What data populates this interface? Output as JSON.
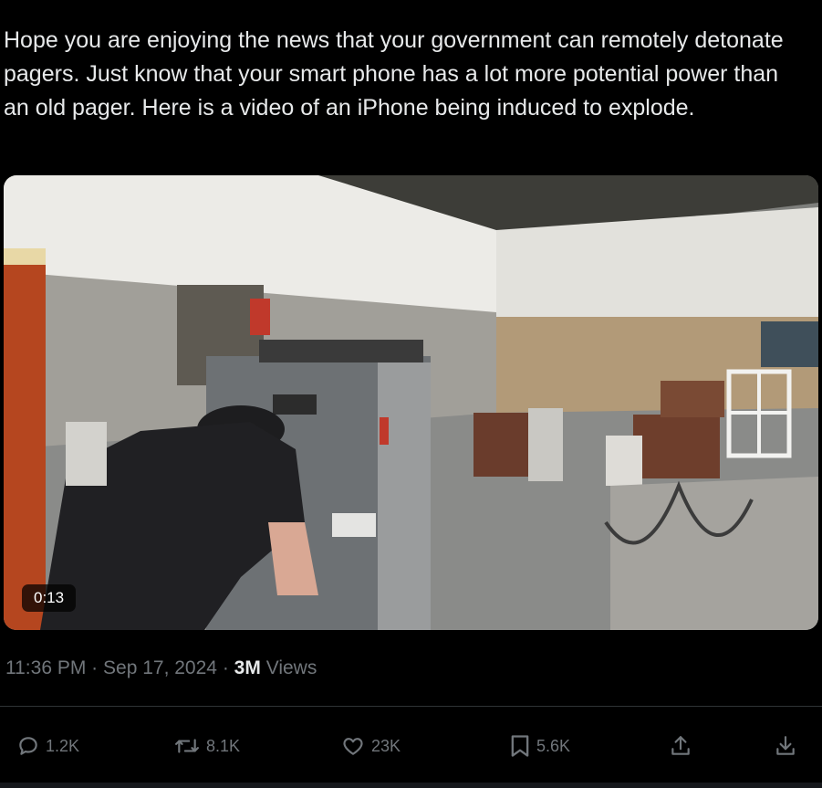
{
  "tweet": {
    "text": "Hope you are enjoying the news that your government can remotely detonate pagers. Just know that your smart phone has a lot more potential power than an old pager. Here is a video of an iPhone being induced to explode."
  },
  "video": {
    "duration": "0:13"
  },
  "meta": {
    "time": "11:36 PM",
    "separator": "·",
    "date": "Sep 17, 2024",
    "views_count": "3M",
    "views_label": "Views"
  },
  "actions": {
    "reply": {
      "icon": "reply-icon",
      "count": "1.2K"
    },
    "retweet": {
      "icon": "retweet-icon",
      "count": "8.1K"
    },
    "like": {
      "icon": "heart-icon",
      "count": "23K"
    },
    "bookmark": {
      "icon": "bookmark-icon",
      "count": "5.6K"
    },
    "share": {
      "icon": "share-icon"
    },
    "download": {
      "icon": "download-icon"
    }
  },
  "colors": {
    "background": "#000000",
    "text": "#e7e9ea",
    "secondary_text": "#71767b",
    "divider": "#2f3336"
  }
}
